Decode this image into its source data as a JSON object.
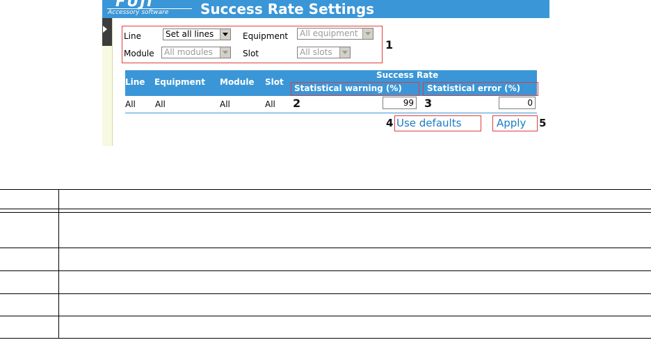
{
  "header": {
    "logo_text": "FUJI",
    "logo_subtitle": "Accessory software",
    "title": "Success Rate Settings"
  },
  "filters": {
    "line_label": "Line",
    "line_value": "Set all lines",
    "equipment_label": "Equipment",
    "equipment_value": "All equipment",
    "module_label": "Module",
    "module_value": "All modules",
    "slot_label": "Slot",
    "slot_value": "All slots"
  },
  "callouts": [
    "1",
    "2",
    "3",
    "4",
    "5"
  ],
  "table": {
    "headers": {
      "line": "Line",
      "equipment": "Equipment",
      "module": "Module",
      "slot": "Slot",
      "success_rate": "Success Rate",
      "warning": "Statistical warning (%)",
      "error": "Statistical error (%)"
    },
    "row": {
      "line": "All",
      "equipment": "All",
      "module": "All",
      "slot": "All",
      "warning_value": "99",
      "error_value": "0"
    }
  },
  "actions": {
    "use_defaults": "Use defaults",
    "apply": "Apply"
  },
  "legend_rows": 6,
  "colors": {
    "header_blue": "#3a96d6",
    "callout_red": "#e03c3c",
    "link_blue": "#1a7cc6"
  }
}
